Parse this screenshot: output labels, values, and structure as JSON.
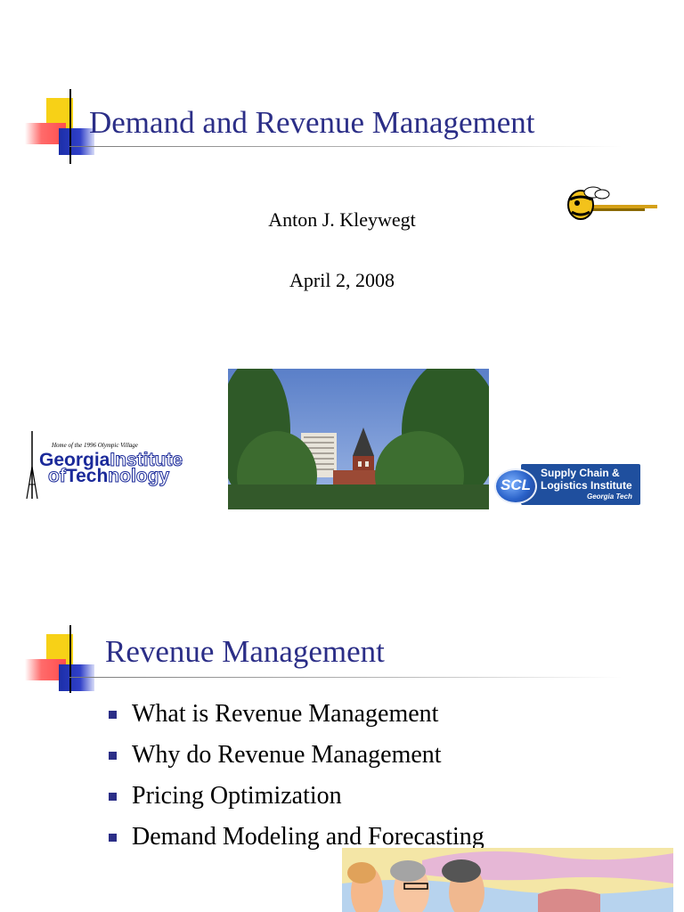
{
  "slide1": {
    "title": "Demand and Revenue Management",
    "author": "Anton J. Kleywegt",
    "date": "April 2, 2008",
    "gt_logo": {
      "tagline": "Home of the 1996 Olympic Village",
      "line1_solid": "Georgia",
      "line1_outline": "Institute",
      "line2_outline1": "of",
      "line2_solid": "Tech",
      "line2_outline2": "nology"
    },
    "scl_logo": {
      "badge": "SCL",
      "line1": "Supply Chain &",
      "line2": "Logistics Institute",
      "line3": "Georgia Tech"
    }
  },
  "slide2": {
    "title": "Revenue Management",
    "bullets": [
      "What is Revenue Management",
      "Why do Revenue Management",
      "Pricing Optimization",
      "Demand Modeling and Forecasting"
    ]
  },
  "colors": {
    "title": "#2b2e87",
    "accent_yellow": "#f7d117",
    "accent_red": "#ff4d4d",
    "accent_blue": "#1b2ea8"
  }
}
